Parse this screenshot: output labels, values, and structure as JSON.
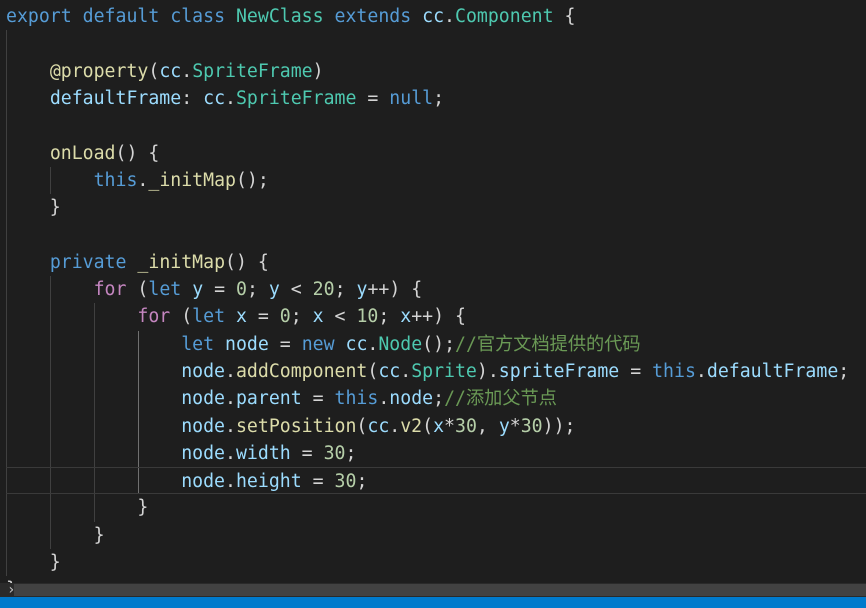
{
  "code_lines": [
    [
      [
        "kw",
        "export"
      ],
      [
        "plain",
        " "
      ],
      [
        "kw",
        "default"
      ],
      [
        "plain",
        " "
      ],
      [
        "kw",
        "class"
      ],
      [
        "plain",
        " "
      ],
      [
        "type",
        "NewClass"
      ],
      [
        "plain",
        " "
      ],
      [
        "kw",
        "extends"
      ],
      [
        "plain",
        " "
      ],
      [
        "var",
        "cc"
      ],
      [
        "plain",
        "."
      ],
      [
        "type",
        "Component"
      ],
      [
        "plain",
        " {"
      ]
    ],
    [],
    [
      [
        "plain",
        "    "
      ],
      [
        "fn",
        "@property"
      ],
      [
        "plain",
        "("
      ],
      [
        "var",
        "cc"
      ],
      [
        "plain",
        "."
      ],
      [
        "type",
        "SpriteFrame"
      ],
      [
        "plain",
        ")"
      ]
    ],
    [
      [
        "plain",
        "    "
      ],
      [
        "var",
        "defaultFrame"
      ],
      [
        "plain",
        ": "
      ],
      [
        "var",
        "cc"
      ],
      [
        "plain",
        "."
      ],
      [
        "type",
        "SpriteFrame"
      ],
      [
        "plain",
        " = "
      ],
      [
        "kw",
        "null"
      ],
      [
        "plain",
        ";"
      ]
    ],
    [],
    [
      [
        "plain",
        "    "
      ],
      [
        "fn",
        "onLoad"
      ],
      [
        "plain",
        "() {"
      ]
    ],
    [
      [
        "plain",
        "        "
      ],
      [
        "kw",
        "this"
      ],
      [
        "plain",
        "."
      ],
      [
        "fn",
        "_initMap"
      ],
      [
        "plain",
        "();"
      ]
    ],
    [
      [
        "plain",
        "    }"
      ]
    ],
    [],
    [
      [
        "plain",
        "    "
      ],
      [
        "kw",
        "private"
      ],
      [
        "plain",
        " "
      ],
      [
        "fn",
        "_initMap"
      ],
      [
        "plain",
        "() {"
      ]
    ],
    [
      [
        "plain",
        "        "
      ],
      [
        "ctrl",
        "for"
      ],
      [
        "plain",
        " ("
      ],
      [
        "kw",
        "let"
      ],
      [
        "plain",
        " "
      ],
      [
        "var",
        "y"
      ],
      [
        "plain",
        " = "
      ],
      [
        "num",
        "0"
      ],
      [
        "plain",
        "; "
      ],
      [
        "var",
        "y"
      ],
      [
        "plain",
        " < "
      ],
      [
        "num",
        "20"
      ],
      [
        "plain",
        "; "
      ],
      [
        "var",
        "y"
      ],
      [
        "plain",
        "++) {"
      ]
    ],
    [
      [
        "plain",
        "            "
      ],
      [
        "ctrl",
        "for"
      ],
      [
        "plain",
        " ("
      ],
      [
        "kw",
        "let"
      ],
      [
        "plain",
        " "
      ],
      [
        "var",
        "x"
      ],
      [
        "plain",
        " = "
      ],
      [
        "num",
        "0"
      ],
      [
        "plain",
        "; "
      ],
      [
        "var",
        "x"
      ],
      [
        "plain",
        " < "
      ],
      [
        "num",
        "10"
      ],
      [
        "plain",
        "; "
      ],
      [
        "var",
        "x"
      ],
      [
        "plain",
        "++) {"
      ]
    ],
    [
      [
        "plain",
        "                "
      ],
      [
        "kw",
        "let"
      ],
      [
        "plain",
        " "
      ],
      [
        "var",
        "node"
      ],
      [
        "plain",
        " = "
      ],
      [
        "kw",
        "new"
      ],
      [
        "plain",
        " "
      ],
      [
        "var",
        "cc"
      ],
      [
        "plain",
        "."
      ],
      [
        "type",
        "Node"
      ],
      [
        "plain",
        "();"
      ],
      [
        "com",
        "//官方文档提供的代码"
      ]
    ],
    [
      [
        "plain",
        "                "
      ],
      [
        "var",
        "node"
      ],
      [
        "plain",
        "."
      ],
      [
        "fn",
        "addComponent"
      ],
      [
        "plain",
        "("
      ],
      [
        "var",
        "cc"
      ],
      [
        "plain",
        "."
      ],
      [
        "type",
        "Sprite"
      ],
      [
        "plain",
        ")."
      ],
      [
        "var",
        "spriteFrame"
      ],
      [
        "plain",
        " = "
      ],
      [
        "kw",
        "this"
      ],
      [
        "plain",
        "."
      ],
      [
        "var",
        "defaultFrame"
      ],
      [
        "plain",
        ";"
      ]
    ],
    [
      [
        "plain",
        "                "
      ],
      [
        "var",
        "node"
      ],
      [
        "plain",
        "."
      ],
      [
        "var",
        "parent"
      ],
      [
        "plain",
        " = "
      ],
      [
        "kw",
        "this"
      ],
      [
        "plain",
        "."
      ],
      [
        "var",
        "node"
      ],
      [
        "plain",
        ";"
      ],
      [
        "com",
        "//添加父节点"
      ]
    ],
    [
      [
        "plain",
        "                "
      ],
      [
        "var",
        "node"
      ],
      [
        "plain",
        "."
      ],
      [
        "fn",
        "setPosition"
      ],
      [
        "plain",
        "("
      ],
      [
        "var",
        "cc"
      ],
      [
        "plain",
        "."
      ],
      [
        "fn",
        "v2"
      ],
      [
        "plain",
        "("
      ],
      [
        "var",
        "x"
      ],
      [
        "plain",
        "*"
      ],
      [
        "num",
        "30"
      ],
      [
        "plain",
        ", "
      ],
      [
        "var",
        "y"
      ],
      [
        "plain",
        "*"
      ],
      [
        "num",
        "30"
      ],
      [
        "plain",
        "));"
      ]
    ],
    [
      [
        "plain",
        "                "
      ],
      [
        "var",
        "node"
      ],
      [
        "plain",
        "."
      ],
      [
        "var",
        "width"
      ],
      [
        "plain",
        " = "
      ],
      [
        "num",
        "30"
      ],
      [
        "plain",
        ";"
      ]
    ],
    [
      [
        "plain",
        "                "
      ],
      [
        "var",
        "node"
      ],
      [
        "plain",
        "."
      ],
      [
        "var",
        "height"
      ],
      [
        "plain",
        " = "
      ],
      [
        "num",
        "30"
      ],
      [
        "plain",
        ";"
      ]
    ],
    [
      [
        "plain",
        "            }"
      ]
    ],
    [
      [
        "plain",
        "        }"
      ]
    ],
    [
      [
        "plain",
        "    }"
      ]
    ],
    [
      [
        "plain",
        "}"
      ]
    ]
  ],
  "colors": {
    "background": "#1e1e1e",
    "keyword": "#569cd6",
    "control": "#c586c0",
    "function": "#dcdcaa",
    "variable": "#9cdcfe",
    "type": "#4ec9b0",
    "number": "#b5cea8",
    "comment": "#6a9955",
    "plain": "#d4d4d4",
    "statusbar": "#007acc"
  },
  "icons": {
    "fold_marker": "chevron-right-icon"
  }
}
